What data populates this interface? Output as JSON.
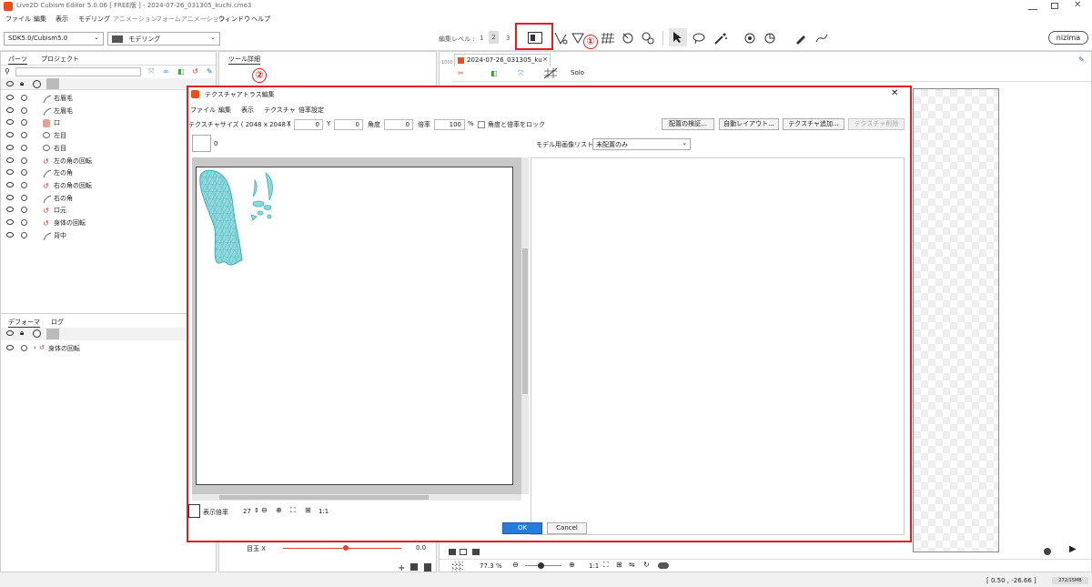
{
  "window": {
    "title": "Live2D Cubism Editor 5.0.06   [ FREE版 ]  - 2024-07-26_031305_kuchi.cmo3",
    "controls": [
      "minimize-icon",
      "maximize-icon",
      "close-icon"
    ]
  },
  "menu": [
    "ファイル",
    "編集",
    "表示",
    "モデリング",
    "アニメーション",
    "フォームアニメーション",
    "ウィンドウ",
    "ヘルプ"
  ],
  "toolbar": {
    "sdk_select": "SDK5.0/Cubism5.0",
    "mode_select": "モデリング",
    "edit_level_label": "編集レベル :",
    "edit_levels": [
      "1",
      "2",
      "3"
    ],
    "brand": "nizima"
  },
  "annotations": {
    "one": "①",
    "two": "②"
  },
  "left_panel": {
    "tabs": [
      "パーツ",
      "プロジェクト"
    ],
    "parts": [
      {
        "name": "右眉毛",
        "icon": "stroke"
      },
      {
        "name": "左眉毛",
        "icon": "stroke"
      },
      {
        "name": "口",
        "icon": "mesh"
      },
      {
        "name": "左目",
        "icon": "ellipse"
      },
      {
        "name": "右目",
        "icon": "ellipse"
      },
      {
        "name": "左の角の回転",
        "icon": "rotation"
      },
      {
        "name": "左の角",
        "icon": "stroke"
      },
      {
        "name": "右の角の回転",
        "icon": "rotation"
      },
      {
        "name": "右の角",
        "icon": "stroke"
      },
      {
        "name": "口元",
        "icon": "rotation"
      },
      {
        "name": "身体の回転",
        "icon": "rotation"
      },
      {
        "name": "背中",
        "icon": "stroke"
      }
    ],
    "deformer_tabs": [
      "デフォーマ",
      "ログ"
    ],
    "deformers": [
      "身体の回転"
    ]
  },
  "tool_detail_tab": "ツール詳細",
  "canvas": {
    "tab_title": "2024-07-26_031305_ku",
    "solo": "Solo",
    "ruler": "1000",
    "zoom": "77.3",
    "zoom_unit": "%",
    "coords": "[  0.50 , -26.66 ]",
    "memory": "272/15MB",
    "ratio": "1:1"
  },
  "param_rows": [
    {
      "label": "目玉 X",
      "value": "0.0"
    }
  ],
  "dialog": {
    "title": "テクスチャアトラス編集",
    "menu": [
      "ファイル",
      "編集",
      "表示",
      "テクスチャ",
      "倍率設定"
    ],
    "texture_size_label": "テクスチャサイズ ( 2048 x 2048 )",
    "x_label": "X",
    "x_value": "0",
    "y_label": "Y",
    "y_value": "0",
    "angle_label": "角度",
    "angle_value": "0",
    "scale_label": "倍率",
    "scale_value": "100",
    "scale_unit": "%",
    "lock_label": "角度と倍率をロック",
    "buttons": [
      "配置の検証...",
      "自動レイアウト...",
      "テクスチャ追加...",
      "テクスチャ削除"
    ],
    "texture_tab": "0",
    "model_image_list_label": "モデル用画像リスト",
    "model_image_filter": "未配置のみ",
    "display_scale_label": "表示倍率",
    "display_scale_value": "27",
    "ratio": "1:1",
    "ok": "OK",
    "cancel": "Cancel"
  }
}
